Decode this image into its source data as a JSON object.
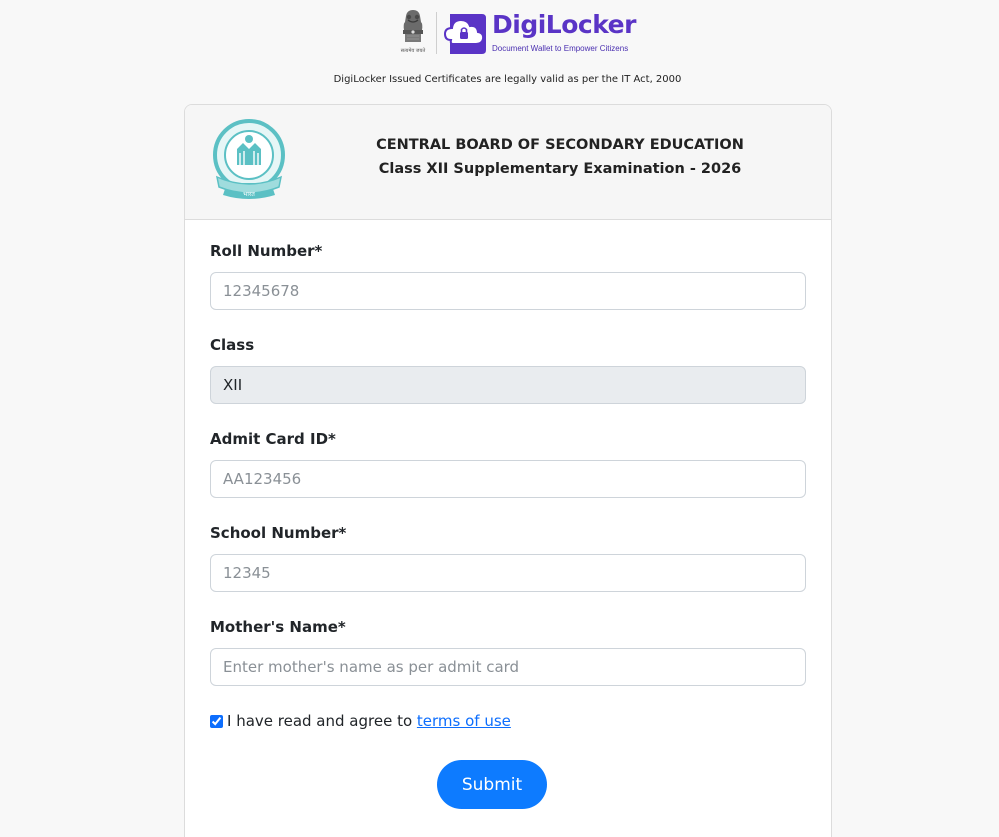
{
  "header": {
    "brand_name": "DigiLocker",
    "brand_tagline": "Document Wallet to Empower Citizens",
    "emblem_caption": "सत्यमेव जयते",
    "legal_note": "DigiLocker Issued Certificates are legally valid as per the IT Act, 2000"
  },
  "card": {
    "board_name": "CENTRAL BOARD OF SECONDARY EDUCATION",
    "exam_name": "Class XII Supplementary Examination - 2026",
    "seal_caption": "भारत"
  },
  "form": {
    "roll_number": {
      "label": "Roll Number*",
      "value": "",
      "placeholder": "12345678"
    },
    "class": {
      "label": "Class",
      "value": "XII",
      "placeholder": ""
    },
    "admit_card_id": {
      "label": "Admit Card ID*",
      "value": "",
      "placeholder": "AA123456"
    },
    "school_number": {
      "label": "School Number*",
      "value": "",
      "placeholder": "12345"
    },
    "mothers_name": {
      "label": "Mother's Name*",
      "value": "",
      "placeholder": "Enter mother's name as per admit card"
    },
    "agree": {
      "text": "I have read and agree to ",
      "link": "terms of use",
      "checked": true
    },
    "submit_label": "Submit"
  },
  "colors": {
    "brand_purple": "#5a34c6",
    "primary_blue": "#0d7bff",
    "link_blue": "#0d6efd",
    "seal_teal": "#5bc0c4",
    "page_bg": "#f8f8f8"
  },
  "icons": {
    "emblem": "national-emblem-icon",
    "digilocker": "digilocker-cloud-lock-icon",
    "seal": "cbse-seal-icon"
  }
}
